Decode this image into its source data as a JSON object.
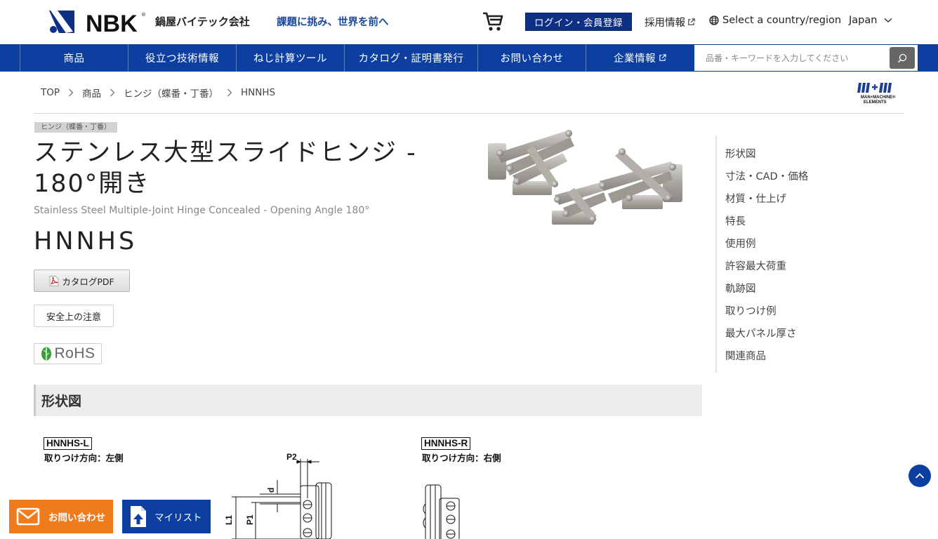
{
  "header": {
    "logo_text": "NBK",
    "company_name": "鍋屋バイテック会社",
    "tagline": "課題に挑み、世界を前へ",
    "login_label": "ログイン・会員登録",
    "recruit_label": "採用情報",
    "country_label": "Select a country/region",
    "country_value": "Japan"
  },
  "nav": {
    "items": [
      {
        "label": "商品"
      },
      {
        "label": "役立つ技術情報"
      },
      {
        "label": "ねじ計算ツール"
      },
      {
        "label": "カタログ・証明書発行"
      },
      {
        "label": "お問い合わせ"
      },
      {
        "label": "企業情報"
      }
    ],
    "search_placeholder": "品番・キーワードを入力してください"
  },
  "breadcrumb": [
    "TOP",
    "商品",
    "ヒンジ（蝶番・丁番）",
    "HNNHS"
  ],
  "brand_logo_text": {
    "line1": "MAN+MACHINE®",
    "line2": "ELEMENTS"
  },
  "product": {
    "category": "ヒンジ（蝶番・丁番）",
    "title": "ステンレス大型スライドヒンジ - 180°開き",
    "subtitle": "Stainless Steel Multiple-Joint Hinge Concealed - Opening Angle 180°",
    "code": "HNNHS",
    "pdf_label": "カタログPDF",
    "safety_label": "安全上の注意",
    "rohs_label": "RoHS"
  },
  "toc": [
    "形状図",
    "寸法・CAD・価格",
    "材質・仕上げ",
    "特長",
    "使用例",
    "許容最大荷重",
    "軌跡図",
    "取りつけ例",
    "最大パネル厚さ",
    "関連商品"
  ],
  "section": {
    "heading": "形状図"
  },
  "drawings": {
    "left": {
      "code": "HNNHS-L",
      "direction": "取りつけ方向：左側",
      "labels": {
        "p2": "P2",
        "d": "d",
        "l1": "L1",
        "p1": "P1"
      }
    },
    "right": {
      "code": "HNNHS-R",
      "direction": "取りつけ方向：右側"
    }
  },
  "floating": {
    "contact_label": "お問い合わせ",
    "mylist_label": "マイリスト"
  },
  "colors": {
    "nav_blue": "#0d3fa0",
    "login_blue": "#0d2f86",
    "contact_orange": "#f07b1c",
    "tagline_blue": "#1a4aa0"
  }
}
